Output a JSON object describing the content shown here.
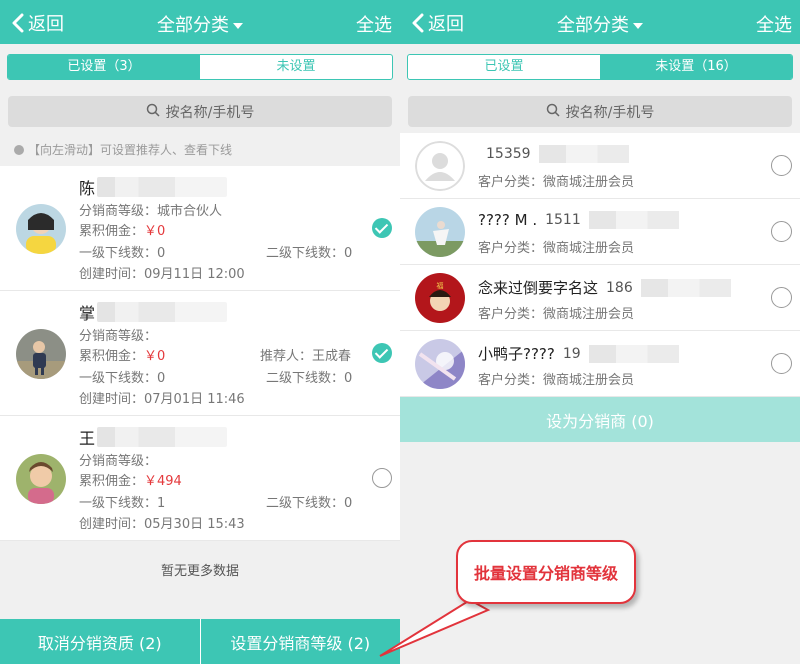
{
  "colors": {
    "accent": "#3dc6b4",
    "accent_light": "#a3e3da",
    "red": "#e4393c"
  },
  "left": {
    "back_label": "返回",
    "title": "全部分类",
    "select_all": "全选",
    "tabs": [
      {
        "label": "已设置（3）",
        "active": true
      },
      {
        "label": "未设置",
        "active": false
      }
    ],
    "search_placeholder": "按名称/手机号",
    "hint": "【向左滑动】可设置推荐人、查看下线",
    "cards": [
      {
        "name": "陈",
        "level": "分销商等级：城市合伙人",
        "commission_label": "累积佣金：",
        "commission_value": "￥0",
        "first_level": "一级下线数：",
        "first_value": "0",
        "second_level": "二级下线数：",
        "second_value": "0",
        "created": "创建时间：09月11日 12:00",
        "referrer": "",
        "checked": true
      },
      {
        "name": "掌",
        "level": "分销商等级：",
        "commission_label": "累积佣金：",
        "commission_value": "￥0",
        "first_level": "一级下线数：",
        "first_value": "0",
        "second_level": "二级下线数：",
        "second_value": "0",
        "created": "创建时间：07月01日 11:46",
        "referrer": "推荐人：王成春",
        "checked": true
      },
      {
        "name": "王",
        "level": "分销商等级：",
        "commission_label": "累积佣金：",
        "commission_value": "￥494",
        "first_level": "一级下线数：",
        "first_value": "1",
        "second_level": "二级下线数：",
        "second_value": "0",
        "created": "创建时间：05月30日 15:43",
        "referrer": "",
        "checked": false
      }
    ],
    "no_more": "暂无更多数据",
    "footer": {
      "cancel": "取消分销资质 (2)",
      "set_level": "设置分销商等级 (2)"
    }
  },
  "right": {
    "back_label": "返回",
    "title": "全部分类",
    "select_all": "全选",
    "tabs": [
      {
        "label": "已设置",
        "active": false
      },
      {
        "label": "未设置（16）",
        "active": true
      }
    ],
    "search_placeholder": "按名称/手机号",
    "items": [
      {
        "name": "",
        "phone": "15359",
        "category": "客户分类：微商城注册会员"
      },
      {
        "name": "???? M .",
        "phone": "1511",
        "category": "客户分类：微商城注册会员"
      },
      {
        "name": "念来过倒要字名这",
        "phone": "186",
        "category": "客户分类：微商城注册会员"
      },
      {
        "name": "小鸭子????",
        "phone": "19",
        "category": "客户分类：微商城注册会员"
      }
    ],
    "set_button": "设为分销商 (0)"
  },
  "callout": "批量设置分销商等级"
}
